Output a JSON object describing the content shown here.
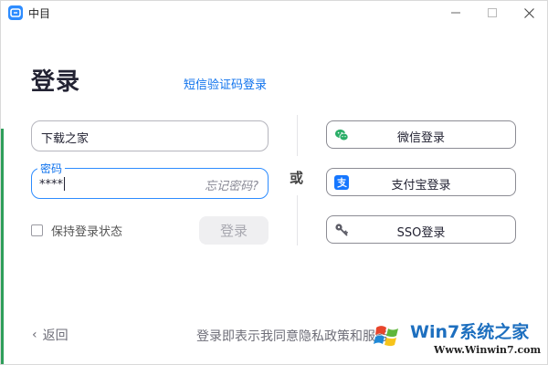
{
  "window": {
    "title": "中目"
  },
  "login": {
    "heading": "登录",
    "sms_link": "短信验证码登录",
    "account_value": "下载之家",
    "password_label": "密码",
    "password_value": "****",
    "forgot_password": "忘记密码?",
    "remember_label": "保持登录状态",
    "remember_checked": false,
    "submit_label": "登录"
  },
  "divider": {
    "or_text": "或"
  },
  "alt_login": {
    "wechat_label": "微信登录",
    "alipay_label": "支付宝登录",
    "sso_label": "SSO登录"
  },
  "footer": {
    "back_label": "返回",
    "terms_text": "登录即表示我同意隐私政策和服务"
  },
  "watermark": {
    "brand_text": "Win7系统之家",
    "url": "Www.Winwin7.com"
  },
  "colors": {
    "accent": "#0e72ed",
    "focus_border": "#2d8cff",
    "wechat": "#2aae67",
    "alipay": "#1677ff",
    "side_strip": "#2f9e5a"
  }
}
